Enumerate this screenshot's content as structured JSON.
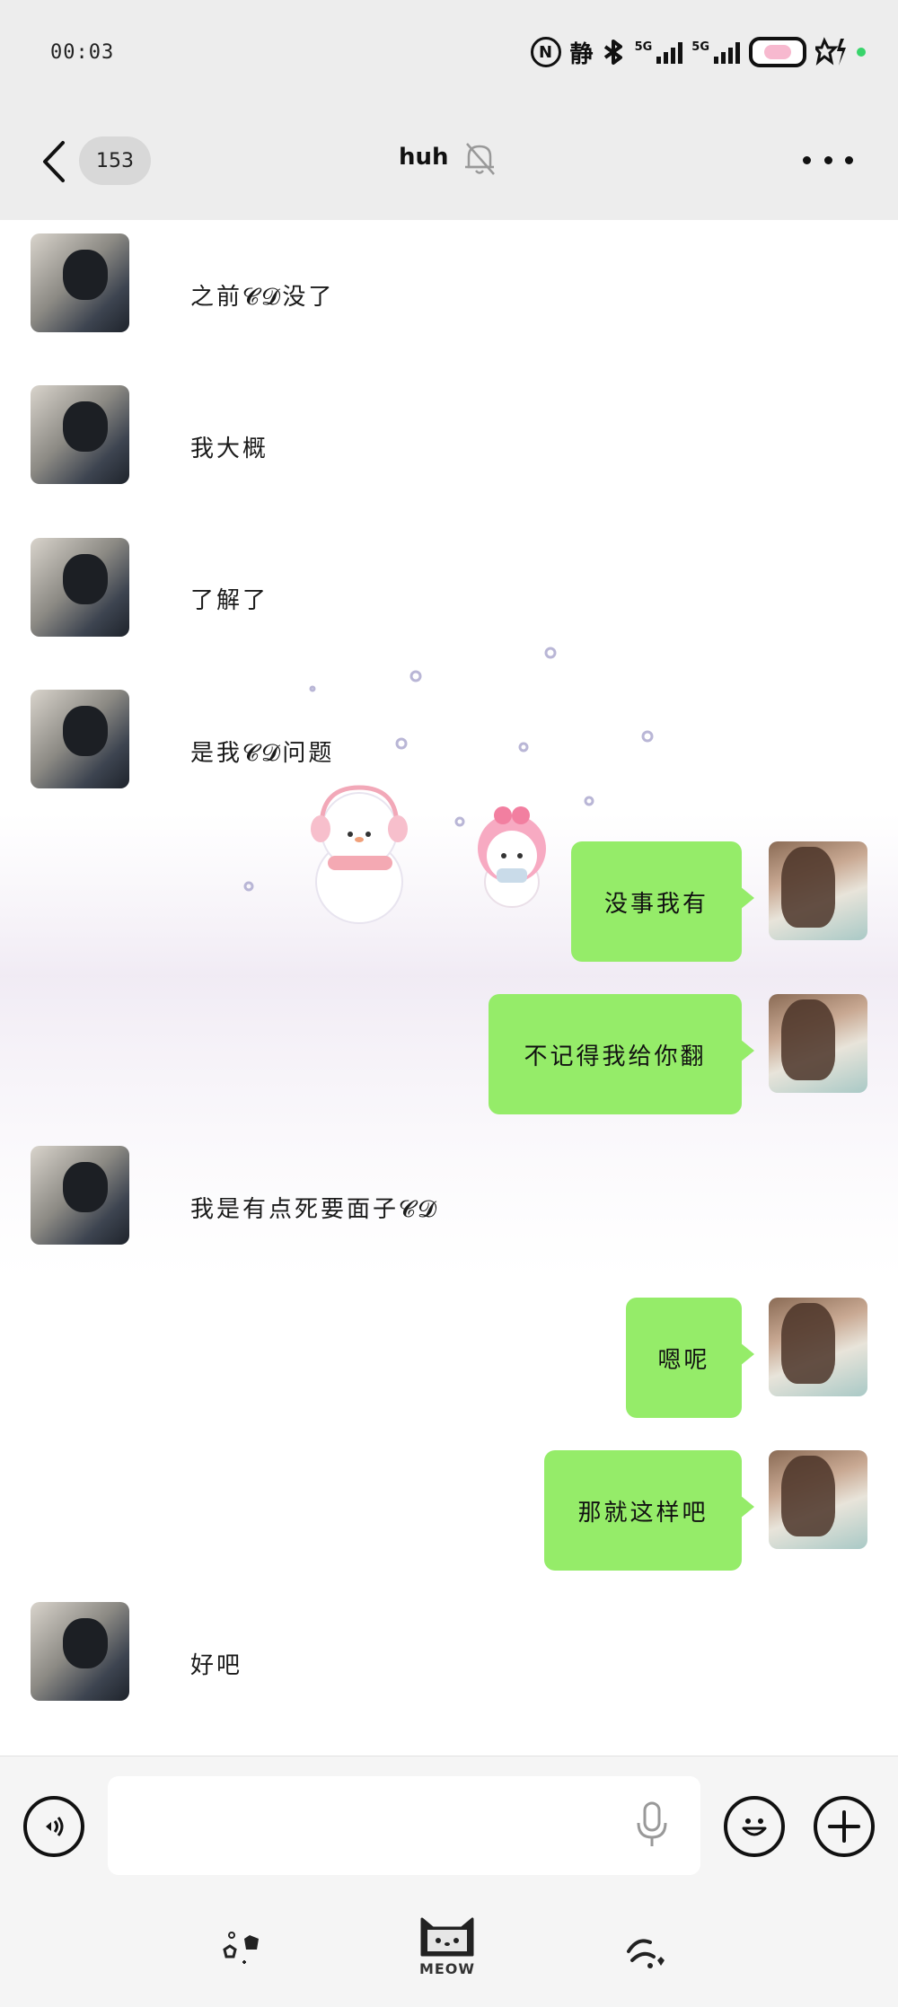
{
  "status_bar": {
    "time": "00:03",
    "silent_label": "静",
    "sim1_label": "5G",
    "sim2_label": "5G",
    "icons": [
      "nfc-icon",
      "bluetooth-icon",
      "signal-icon",
      "battery-icon",
      "charging-icon"
    ]
  },
  "header": {
    "back_icon": "chevron-left-icon",
    "unread_count": "153",
    "title": "huh",
    "mute_icon": "bell-off-icon",
    "more_icon": "more-dots-icon"
  },
  "messages": [
    {
      "from": "them",
      "text": "之前𝓒𝓓没了"
    },
    {
      "from": "them",
      "text": "我大概"
    },
    {
      "from": "them",
      "text": "了解了"
    },
    {
      "from": "them",
      "text": "是我𝓒𝓓问题"
    },
    {
      "from": "me",
      "text": "没事我有"
    },
    {
      "from": "me",
      "text": "不记得我给你翻"
    },
    {
      "from": "them",
      "text": "我是有点死要面子𝓒𝓓"
    },
    {
      "from": "me",
      "text": "嗯呢"
    },
    {
      "from": "me",
      "text": "那就这样吧"
    },
    {
      "from": "them",
      "text": "好吧"
    }
  ],
  "input_bar": {
    "voice_icon": "voice-icon",
    "message_placeholder": "",
    "mic_icon": "mic-icon",
    "emoji_icon": "emoji-icon",
    "plus_icon": "plus-icon"
  },
  "toolbar": {
    "left_icon": "sparkle-icon",
    "center_label": "MEOW",
    "right_icon": "swirl-icon"
  },
  "colors": {
    "outgoing_bubble": "#95ec69",
    "header_bg": "#ededed",
    "chat_bg": "#ffffff"
  }
}
